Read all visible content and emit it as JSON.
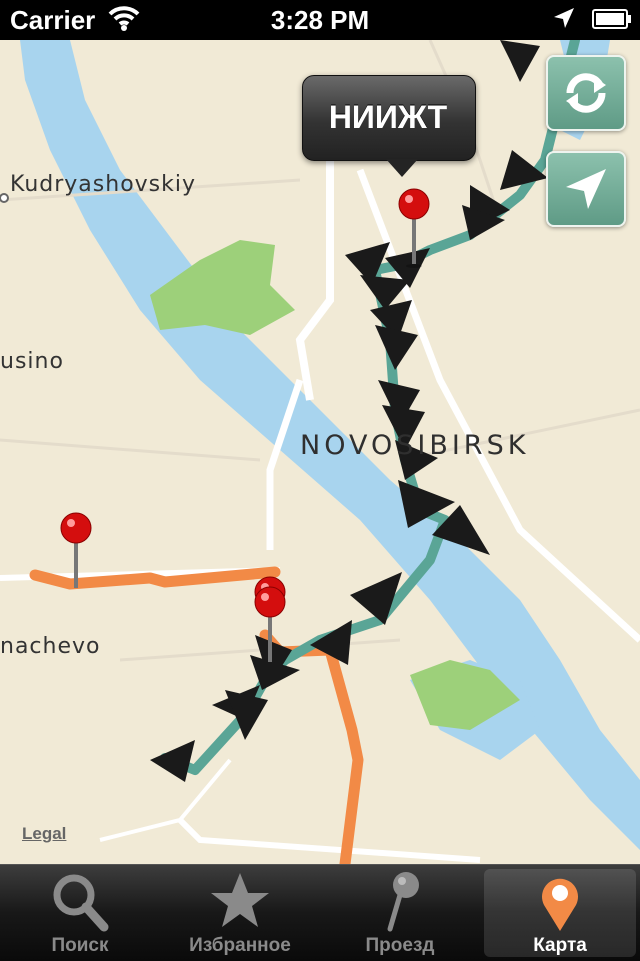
{
  "status_bar": {
    "carrier": "Carrier",
    "time": "3:28 PM"
  },
  "map": {
    "labels": {
      "kudryashovskiy": "Kudryashovskiy",
      "usino": "usino",
      "nachevo": "nachevo",
      "novosibirsk": "Novosibirsk"
    },
    "legal": "Legal",
    "callout_title": "НИИЖТ",
    "colors": {
      "water": "#a8d4ee",
      "park": "#9dd07a",
      "route_teal": "#5aa596",
      "route_orange": "#f28a46"
    }
  },
  "map_buttons": {
    "refresh_icon": "refresh-icon",
    "locate_icon": "location-arrow-icon"
  },
  "tab_bar": {
    "tabs": [
      {
        "label": "Поиск",
        "icon": "search-icon"
      },
      {
        "label": "Избранное",
        "icon": "star-icon"
      },
      {
        "label": "Проезд",
        "icon": "pin-icon"
      },
      {
        "label": "Карта",
        "icon": "map-pin-icon"
      }
    ],
    "active_index": 3
  }
}
